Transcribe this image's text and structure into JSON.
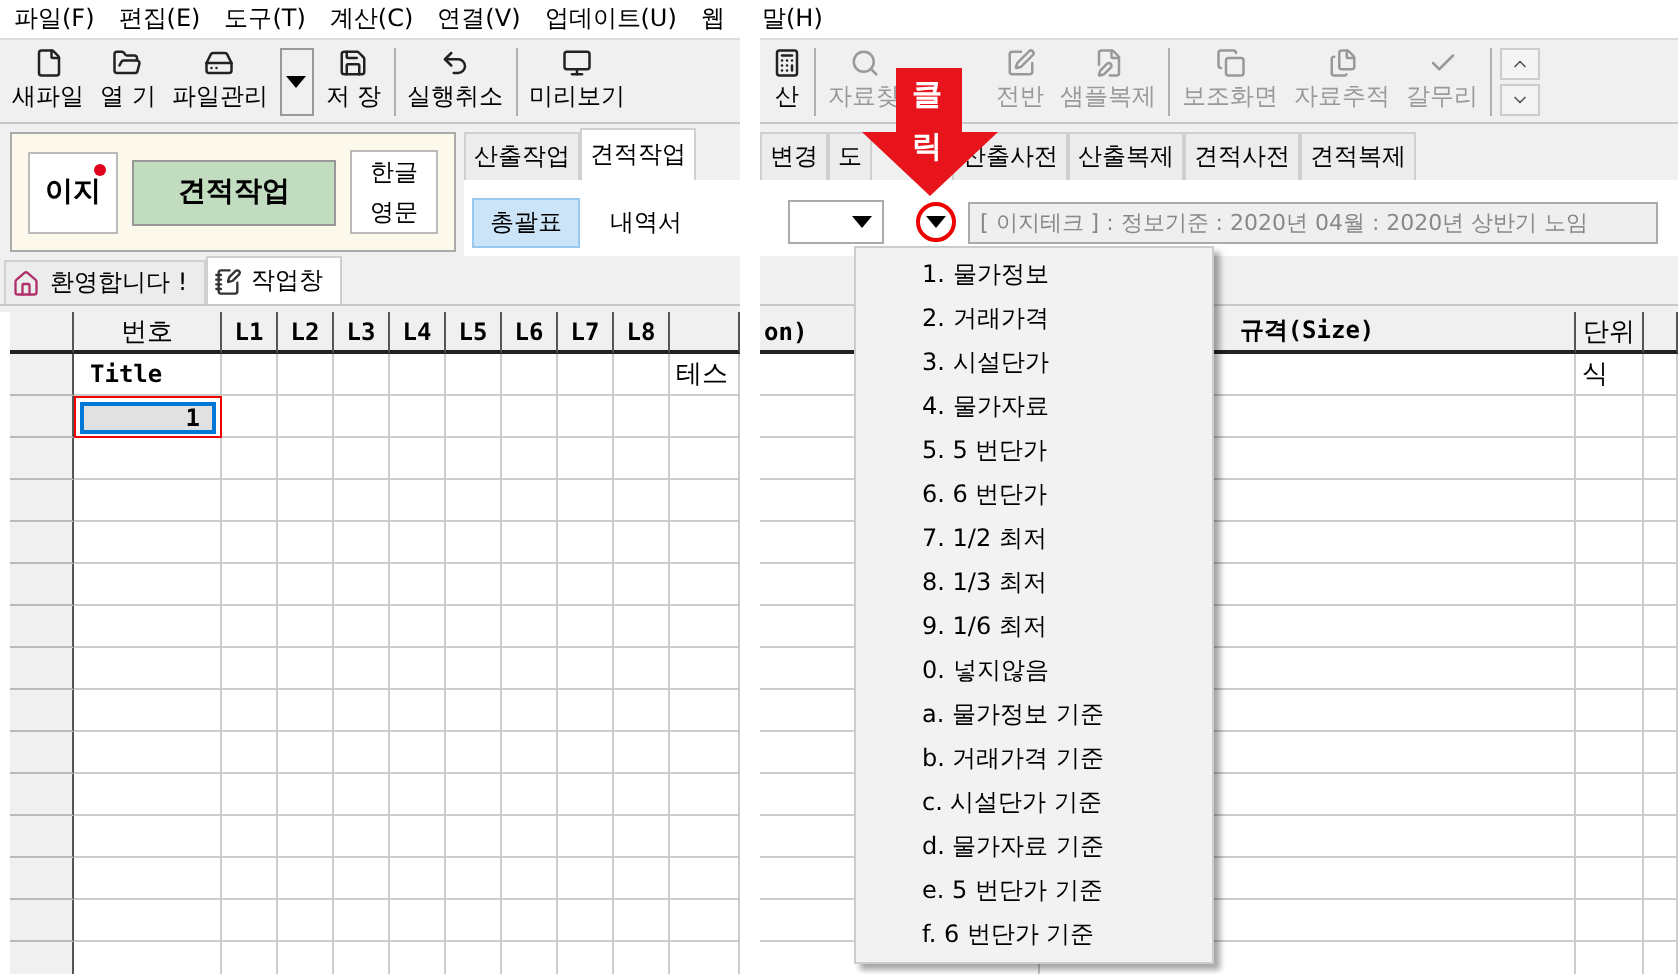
{
  "left_pane": {
    "menu_bar": [
      "파일(F)",
      "편집(E)",
      "도구(T)",
      "계산(C)",
      "연결(V)",
      "업데이트(U)",
      "웹"
    ],
    "toolbar": [
      {
        "label": "새파일",
        "disabled": false
      },
      {
        "label": "열 기",
        "disabled": false
      },
      {
        "label": "파일관리",
        "disabled": false
      },
      {
        "kind": "dropdown",
        "disabled": false
      },
      {
        "label": "저 장",
        "disabled": false
      },
      {
        "kind": "separator"
      },
      {
        "label": "실행취소",
        "disabled": false
      },
      {
        "kind": "separator"
      },
      {
        "label": "미리보기",
        "disabled": false
      }
    ],
    "brand_panel": {
      "logo": "이지",
      "mode_button": "견적작업",
      "language": [
        "한글",
        "영문"
      ]
    },
    "tabs": [
      {
        "label": "산출작업",
        "selected": false
      },
      {
        "label": "견적작업",
        "selected": true
      }
    ],
    "sub_tabs": [
      {
        "label": "총괄표",
        "selected": true
      },
      {
        "label": "내역서",
        "selected": false
      }
    ],
    "doc_tabs": [
      {
        "label": "환영합니다 !",
        "selected": false
      },
      {
        "label": "작업창",
        "selected": true
      }
    ],
    "grid": {
      "columns": [
        "번호",
        "L1",
        "L2",
        "L3",
        "L4",
        "L5",
        "L6",
        "L7",
        "L8"
      ],
      "rows": [
        {
          "number": "Title",
          "description": "테스",
          "selected": false
        },
        {
          "number": "1",
          "selected": true
        }
      ]
    }
  },
  "right_pane": {
    "menu_bar": [
      "말(H)"
    ],
    "toolbar": [
      {
        "label": "산",
        "disabled": false
      },
      {
        "kind": "separator"
      },
      {
        "label": "자료찾",
        "disabled": true
      },
      {
        "label": "전반",
        "disabled": true
      },
      {
        "label": "샘플복제",
        "disabled": true
      },
      {
        "kind": "separator"
      },
      {
        "label": "보조화면",
        "disabled": true
      },
      {
        "label": "자료추적",
        "disabled": true
      },
      {
        "label": "갈무리",
        "disabled": true
      },
      {
        "kind": "separator"
      },
      {
        "kind": "scroll"
      }
    ],
    "tabs": [
      {
        "label": "변경",
        "selected": false
      },
      {
        "label": "도",
        "selected": false
      },
      {
        "label": "산출사전",
        "selected": false
      },
      {
        "label": "산출복제",
        "selected": false
      },
      {
        "label": "견적사전",
        "selected": false
      },
      {
        "label": "견적복제",
        "selected": false
      }
    ],
    "status": "[ 이지테크 ] : 정보기준 : 2020년 04월 : 2020년 상반기 노임",
    "grid": {
      "columns": [
        "on)",
        "규격(Size)",
        "단위"
      ],
      "rows": [
        {
          "unit": "식"
        }
      ]
    }
  },
  "callout": {
    "text": [
      "클",
      "릭"
    ]
  },
  "dropdown_menu": {
    "items": [
      "1. 물가정보",
      "2. 거래가격",
      "3. 시설단가",
      "4. 물가자료",
      "5. 5 번단가",
      "6. 6 번단가",
      "7. 1/2 최저",
      "8. 1/3 최저",
      "9. 1/6 최저",
      "0. 넣지않음",
      "a. 물가정보 기준",
      "b. 거래가격 기준",
      "c. 시설단가 기준",
      "d. 물가자료 기준",
      "e. 5 번단가 기준",
      "f. 6 번단가 기준"
    ]
  }
}
